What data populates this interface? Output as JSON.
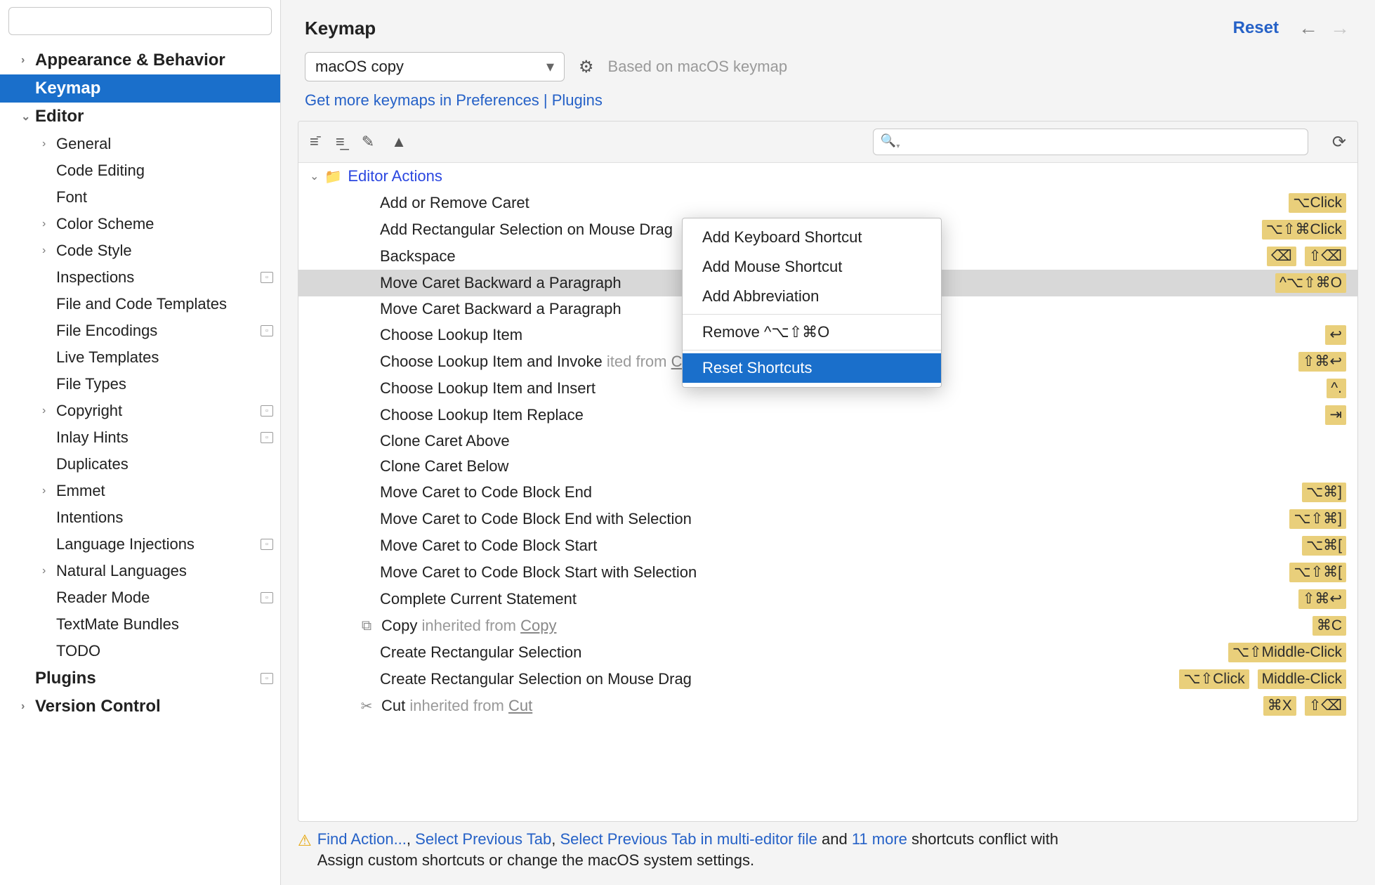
{
  "header": {
    "title": "Keymap",
    "reset": "Reset"
  },
  "keymap": {
    "selected": "macOS copy",
    "based_on": "Based on macOS keymap",
    "plugins_link": "Get more keymaps in Preferences | Plugins"
  },
  "sidebar": {
    "search_placeholder": "",
    "items": [
      {
        "label": "Appearance & Behavior",
        "level": 0,
        "arrow": "›",
        "bold": true
      },
      {
        "label": "Keymap",
        "level": 0,
        "arrow": "",
        "bold": true,
        "selected": true
      },
      {
        "label": "Editor",
        "level": 0,
        "arrow": "⌄",
        "bold": true
      },
      {
        "label": "General",
        "level": 1,
        "arrow": "›"
      },
      {
        "label": "Code Editing",
        "level": 1,
        "arrow": ""
      },
      {
        "label": "Font",
        "level": 1,
        "arrow": ""
      },
      {
        "label": "Color Scheme",
        "level": 1,
        "arrow": "›"
      },
      {
        "label": "Code Style",
        "level": 1,
        "arrow": "›"
      },
      {
        "label": "Inspections",
        "level": 1,
        "arrow": "",
        "badge": true
      },
      {
        "label": "File and Code Templates",
        "level": 1,
        "arrow": ""
      },
      {
        "label": "File Encodings",
        "level": 1,
        "arrow": "",
        "badge": true
      },
      {
        "label": "Live Templates",
        "level": 1,
        "arrow": ""
      },
      {
        "label": "File Types",
        "level": 1,
        "arrow": ""
      },
      {
        "label": "Copyright",
        "level": 1,
        "arrow": "›",
        "badge": true
      },
      {
        "label": "Inlay Hints",
        "level": 1,
        "arrow": "",
        "badge": true
      },
      {
        "label": "Duplicates",
        "level": 1,
        "arrow": ""
      },
      {
        "label": "Emmet",
        "level": 1,
        "arrow": "›"
      },
      {
        "label": "Intentions",
        "level": 1,
        "arrow": ""
      },
      {
        "label": "Language Injections",
        "level": 1,
        "arrow": "",
        "badge": true
      },
      {
        "label": "Natural Languages",
        "level": 1,
        "arrow": "›"
      },
      {
        "label": "Reader Mode",
        "level": 1,
        "arrow": "",
        "badge": true
      },
      {
        "label": "TextMate Bundles",
        "level": 1,
        "arrow": ""
      },
      {
        "label": "TODO",
        "level": 1,
        "arrow": ""
      },
      {
        "label": "Plugins",
        "level": 0,
        "arrow": "",
        "bold": true,
        "badge": true
      },
      {
        "label": "Version Control",
        "level": 0,
        "arrow": "›",
        "bold": true
      }
    ]
  },
  "actions_group": {
    "label": "Editor Actions"
  },
  "actions": [
    {
      "label": "Add or Remove Caret",
      "shortcuts": [
        "⌥Click"
      ]
    },
    {
      "label": "Add Rectangular Selection on Mouse Drag",
      "shortcuts": [
        "⌥⇧⌘Click"
      ]
    },
    {
      "label": "Backspace",
      "shortcuts": [
        "⌫",
        "⇧⌫"
      ]
    },
    {
      "label": "Move Caret Backward a Paragraph",
      "shortcuts": [
        "^⌥⇧⌘O"
      ],
      "selected": true
    },
    {
      "label": "Move Caret Backward a Paragraph",
      "shortcuts": []
    },
    {
      "label": "Choose Lookup Item",
      "shortcuts": [
        "↩"
      ]
    },
    {
      "label": "Choose Lookup Item and Invoke",
      "inherited_text": "ited from",
      "inherited_link": "Complete Current Statement",
      "shortcuts": [
        "⇧⌘↩"
      ]
    },
    {
      "label": "Choose Lookup Item and Insert",
      "shortcuts": [
        "^."
      ]
    },
    {
      "label": "Choose Lookup Item Replace",
      "shortcuts": [
        "⇥"
      ]
    },
    {
      "label": "Clone Caret Above",
      "shortcuts": []
    },
    {
      "label": "Clone Caret Below",
      "shortcuts": []
    },
    {
      "label": "Move Caret to Code Block End",
      "shortcuts": [
        "⌥⌘]"
      ]
    },
    {
      "label": "Move Caret to Code Block End with Selection",
      "shortcuts": [
        "⌥⇧⌘]"
      ]
    },
    {
      "label": "Move Caret to Code Block Start",
      "shortcuts": [
        "⌥⌘["
      ]
    },
    {
      "label": "Move Caret to Code Block Start with Selection",
      "shortcuts": [
        "⌥⇧⌘["
      ]
    },
    {
      "label": "Complete Current Statement",
      "shortcuts": [
        "⇧⌘↩"
      ]
    },
    {
      "label": "Copy",
      "icon": "copy",
      "inherited_text": "inherited from",
      "inherited_link": "Copy",
      "shortcuts": [
        "⌘C"
      ]
    },
    {
      "label": "Create Rectangular Selection",
      "shortcuts": [
        "⌥⇧Middle-Click"
      ]
    },
    {
      "label": "Create Rectangular Selection on Mouse Drag",
      "shortcuts": [
        "⌥⇧Click",
        "Middle-Click"
      ]
    },
    {
      "label": "Cut",
      "icon": "cut",
      "inherited_text": "inherited from",
      "inherited_link": "Cut",
      "shortcuts": [
        "⌘X",
        "⇧⌫"
      ]
    }
  ],
  "context_menu": {
    "items": [
      {
        "label": "Add Keyboard Shortcut"
      },
      {
        "label": "Add Mouse Shortcut"
      },
      {
        "label": "Add Abbreviation"
      },
      {
        "sep": true
      },
      {
        "label": "Remove ^⌥⇧⌘O"
      },
      {
        "sep": true
      },
      {
        "label": "Reset Shortcuts",
        "highlight": true
      }
    ]
  },
  "footer": {
    "links": [
      "Find Action...",
      "Select Previous Tab",
      "Select Previous Tab in multi-editor file",
      "11 more"
    ],
    "text_and": " and ",
    "text_conflict": " shortcuts conflict with",
    "text_advice": "Assign custom shortcuts or change the macOS system settings."
  }
}
